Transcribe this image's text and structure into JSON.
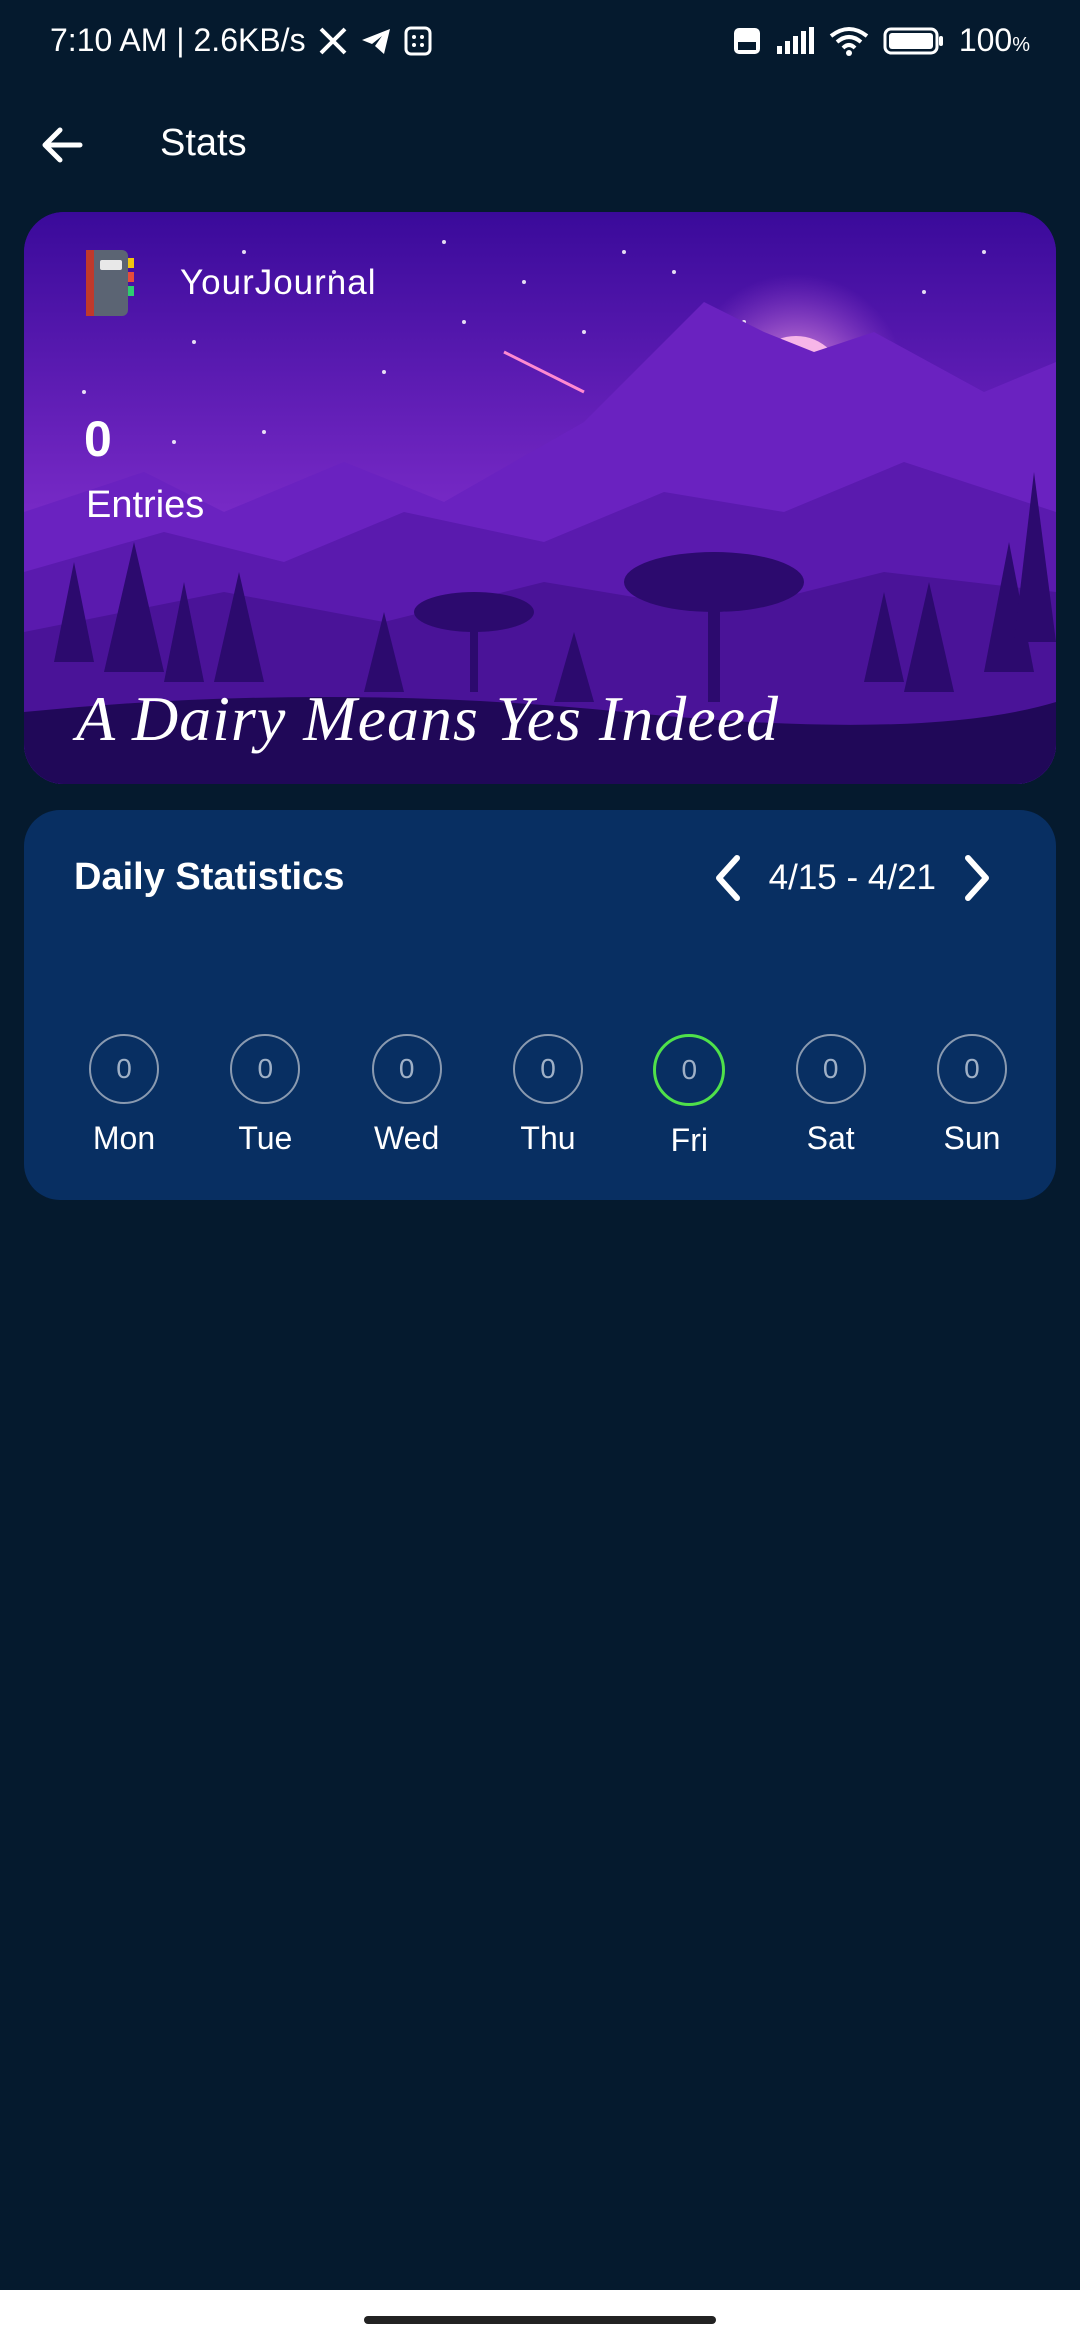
{
  "status_bar": {
    "time_speed": "7:10 AM | 2.6KB/s",
    "battery": "100",
    "battery_unit": "%"
  },
  "app_bar": {
    "title": "Stats"
  },
  "hero": {
    "app_name": "YourJournal",
    "entries_count": "0",
    "entries_label": "Entries",
    "quote": "A Dairy Means Yes Indeed"
  },
  "stats": {
    "title": "Daily Statistics",
    "range": "4/15 - 4/21",
    "days": [
      {
        "label": "Mon",
        "value": "0"
      },
      {
        "label": "Tue",
        "value": "0"
      },
      {
        "label": "Wed",
        "value": "0"
      },
      {
        "label": "Thu",
        "value": "0"
      },
      {
        "label": "Fri",
        "value": "0"
      },
      {
        "label": "Sat",
        "value": "0"
      },
      {
        "label": "Sun",
        "value": "0"
      }
    ],
    "today": "Fri",
    "today_color": "#4fe14a"
  },
  "colors": {
    "background": "#051a2e",
    "stats_card": "#082f62",
    "hero_sky": "#3a0c8c"
  }
}
